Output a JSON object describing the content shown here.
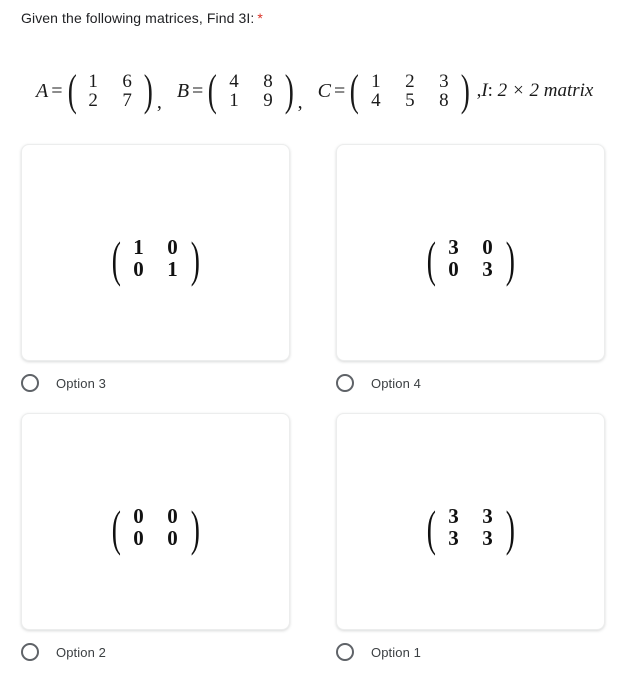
{
  "question": {
    "text": "Given the following matrices, Find 3I:",
    "required_marker": "*",
    "required_color": "#d93025",
    "text_color": "#202124"
  },
  "statement": {
    "matrices": [
      {
        "label": "A",
        "equals": "=",
        "rows": [
          [
            "1",
            "6"
          ],
          [
            "2",
            "7"
          ]
        ],
        "separator": ","
      },
      {
        "label": "B",
        "equals": "=",
        "rows": [
          [
            "4",
            "8"
          ],
          [
            "1",
            "9"
          ]
        ],
        "separator": ","
      },
      {
        "label": "C",
        "equals": "=",
        "rows": [
          [
            "1",
            "2",
            "3"
          ],
          [
            "4",
            "5",
            "8"
          ]
        ],
        "separator": ""
      }
    ],
    "identity_note": {
      "prefix": ",",
      "symbol": "I",
      "colon": ":",
      "description": "2 × 2 matrix"
    },
    "open_paren": "(",
    "close_paren": ")"
  },
  "options": [
    {
      "label": "Option 3",
      "matrix": {
        "rows": [
          [
            "1",
            "0"
          ],
          [
            "0",
            "1"
          ]
        ]
      }
    },
    {
      "label": "Option 4",
      "matrix": {
        "rows": [
          [
            "3",
            "0"
          ],
          [
            "0",
            "3"
          ]
        ]
      }
    },
    {
      "label": "Option 2",
      "matrix": {
        "rows": [
          [
            "0",
            "0"
          ],
          [
            "0",
            "0"
          ]
        ]
      }
    },
    {
      "label": "Option 1",
      "matrix": {
        "rows": [
          [
            "3",
            "3"
          ],
          [
            "3",
            "3"
          ]
        ]
      }
    }
  ],
  "theme": {
    "background": "#ffffff",
    "card_border": "#eceded",
    "radio_border": "#5f6368",
    "label_color": "#3c4043"
  }
}
